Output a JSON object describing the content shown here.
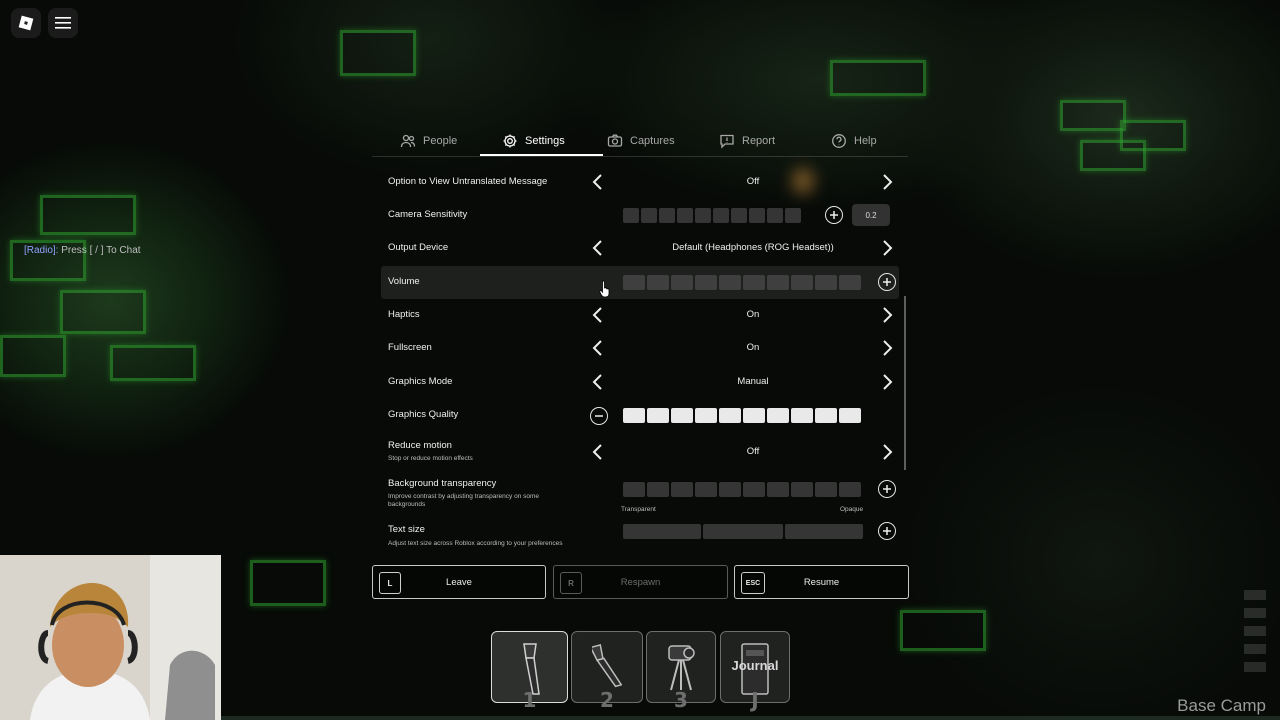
{
  "chat_hint": {
    "tag": "[Radio]:",
    "text": "Press [ / ] To Chat"
  },
  "tabs": [
    {
      "label": "People",
      "icon": "people-icon",
      "active": false
    },
    {
      "label": "Settings",
      "icon": "gear-icon",
      "active": true
    },
    {
      "label": "Captures",
      "icon": "camera-icon",
      "active": false
    },
    {
      "label": "Report",
      "icon": "report-icon",
      "active": false
    },
    {
      "label": "Help",
      "icon": "help-icon",
      "active": false
    }
  ],
  "settings": {
    "untranslated": {
      "label": "Option to View Untranslated Message",
      "value": "Off"
    },
    "camera_sensitivity": {
      "label": "Camera Sensitivity",
      "value": "0.2",
      "level": 0
    },
    "output_device": {
      "label": "Output Device",
      "value": "Default (Headphones (ROG Headset))"
    },
    "volume": {
      "label": "Volume",
      "level": 0
    },
    "haptics": {
      "label": "Haptics",
      "value": "On"
    },
    "fullscreen": {
      "label": "Fullscreen",
      "value": "On"
    },
    "graphics_mode": {
      "label": "Graphics Mode",
      "value": "Manual"
    },
    "graphics_quality": {
      "label": "Graphics Quality",
      "level": 10
    },
    "reduce_motion": {
      "label": "Reduce motion",
      "description": "Stop or reduce motion effects",
      "value": "Off"
    },
    "background_transparency": {
      "label": "Background transparency",
      "description": "Improve contrast by adjusting transparency on some backgrounds",
      "min_label": "Transparent",
      "max_label": "Opaque",
      "level": 0
    },
    "text_size": {
      "label": "Text size",
      "description": "Adjust text size across Roblox according to your preferences",
      "level": 0
    }
  },
  "buttons": {
    "leave": {
      "key": "L",
      "label": "Leave"
    },
    "respawn": {
      "key": "R",
      "label": "Respawn"
    },
    "resume": {
      "key": "ESC",
      "label": "Resume"
    }
  },
  "hotbar": [
    {
      "num": "1",
      "item": "flashlight-icon",
      "selected": true
    },
    {
      "num": "2",
      "item": "flashlight-icon",
      "selected": false
    },
    {
      "num": "3",
      "item": "camera-tripod-icon",
      "selected": false
    },
    {
      "num": "J",
      "item": "journal-icon",
      "label": "Journal",
      "selected": false
    }
  ],
  "location": "Base Camp",
  "colors": {
    "accent": "#ffffff",
    "wall_glow": "#2fa32f"
  }
}
